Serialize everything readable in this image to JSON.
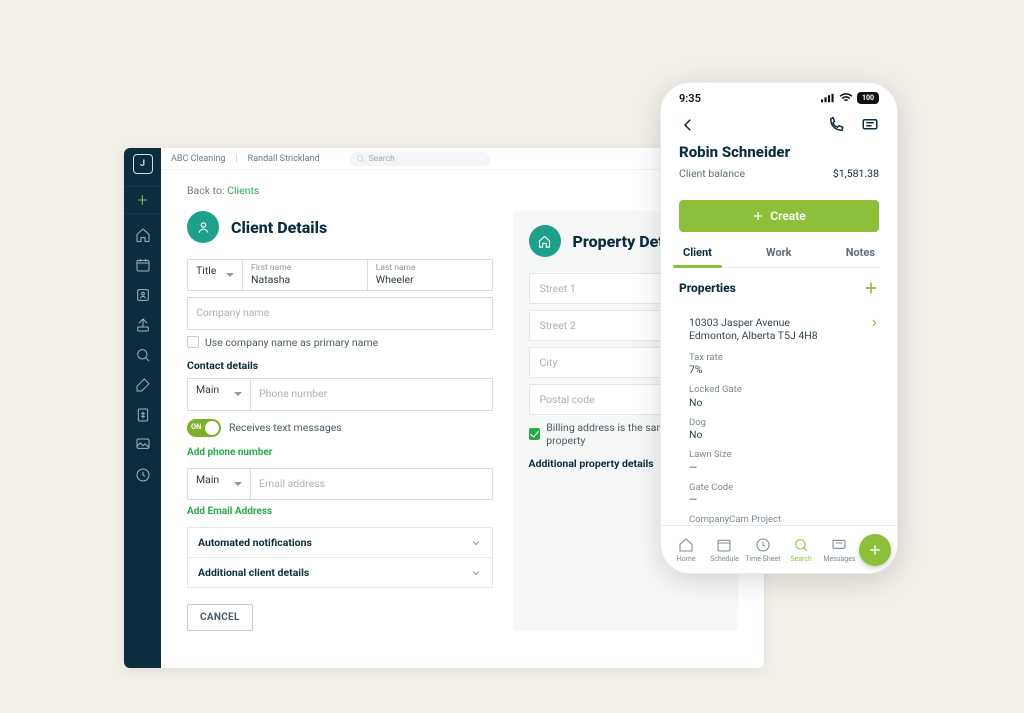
{
  "desktop": {
    "breadcrumb": {
      "org": "ABC Cleaning",
      "user": "Randall Strickland"
    },
    "search_placeholder": "Search",
    "back_prefix": "Back to:",
    "back_link": "Clients",
    "client_panel": {
      "title": "Client Details",
      "title_field_label": "Title",
      "first_name_label": "First name",
      "first_name_value": "Natasha",
      "last_name_label": "Last name",
      "last_name_value": "Wheeler",
      "company_placeholder": "Company name",
      "use_company_checkbox": "Use company name as primary name",
      "contact_details_label": "Contact details",
      "phone_type": "Main",
      "phone_placeholder": "Phone number",
      "receives_texts_label": "Receives text messages",
      "toggle_on": "ON",
      "add_phone_link": "Add phone number",
      "email_type": "Main",
      "email_placeholder": "Email address",
      "add_email_link": "Add Email Address",
      "accordion": {
        "automated_notifications": "Automated notifications",
        "additional_details": "Additional client details"
      },
      "cancel": "CANCEL"
    },
    "property_panel": {
      "title": "Property Details",
      "street1": "Street 1",
      "street2": "Street 2",
      "city": "City",
      "postal": "Postal code",
      "billing_same": "Billing address is the same as property",
      "additional_heading": "Additional property details"
    }
  },
  "phone": {
    "time": "9:35",
    "battery": "100",
    "client_name": "Robin Schneider",
    "balance_label": "Client balance",
    "balance_value": "$1,581.38",
    "create_label": "Create",
    "tabs": {
      "client": "Client",
      "work": "Work",
      "notes": "Notes"
    },
    "properties_heading": "Properties",
    "address_line1": "10303 Jasper Avenue",
    "address_line2": "Edmonton, Alberta T5J 4H8",
    "fields": {
      "tax_rate_k": "Tax rate",
      "tax_rate_v": "7%",
      "locked_gate_k": "Locked Gate",
      "locked_gate_v": "No",
      "dog_k": "Dog",
      "dog_v": "No",
      "lawn_size_k": "Lawn Size",
      "lawn_size_v": "—",
      "gate_code_k": "Gate Code",
      "gate_code_v": "—",
      "companycam_k": "CompanyCam Project"
    },
    "tabbar": {
      "home": "Home",
      "schedule": "Schedule",
      "timesheet": "Time Sheet",
      "search": "Search",
      "messages": "Messages"
    }
  }
}
